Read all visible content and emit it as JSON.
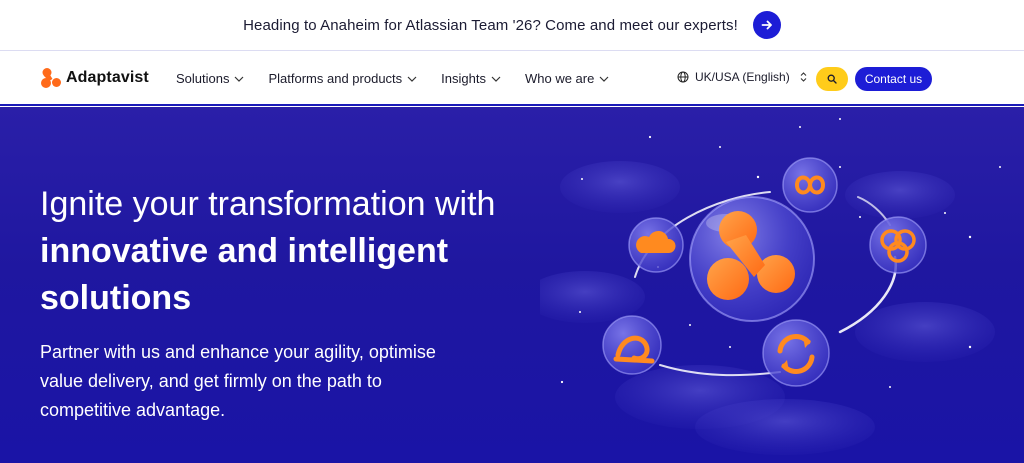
{
  "banner": {
    "text": "Heading to Anaheim for Atlassian Team '26? Come and meet our experts!",
    "arrow_icon": "arrow-right-icon"
  },
  "nav": {
    "logo": "Adaptavist",
    "items": [
      {
        "label": "Solutions"
      },
      {
        "label": "Platforms and products"
      },
      {
        "label": "Insights"
      },
      {
        "label": "Who we are"
      }
    ],
    "language": "UK/USA (English)",
    "contact": "Contact us"
  },
  "hero": {
    "title_light": "Ignite your transformation with ",
    "title_bold": "innovative and intelligent solutions",
    "subtitle": "Partner with us and enhance your agility, optimise value delivery, and get firmly on the path to competitive advantage."
  },
  "colors": {
    "brand_blue": "#1d1dd6",
    "hero_bg": "#1f17a0",
    "accent_yellow": "#ffcc1a",
    "accent_orange": "#ff7a1a"
  }
}
